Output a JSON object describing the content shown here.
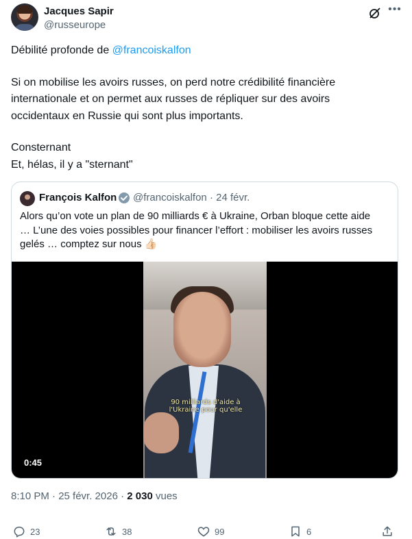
{
  "author": {
    "name": "Jacques Sapir",
    "handle": "@russeurope"
  },
  "tweet": {
    "line1_prefix": "Débilité profonde de ",
    "line1_mention": "@francoiskalfon",
    "para2": "Si on mobilise les avoirs russes, on perd notre crédibilité financière\ninternationale et on permet aux russes de répliquer sur des avoirs\noccidentaux en Russie qui sont plus importants.",
    "para3": "Consternant\nEt, hélas, il y a \"sternant\""
  },
  "quote": {
    "name": "François Kalfon",
    "handle_date": "@francoiskalfon · 24 févr.",
    "text": "Alors qu’on vote un plan de 90 milliards € à Ukraine, Orban bloque cette aide\n… L’une des voies possibles pour financer l’effort : mobiliser les avoirs russes\ngelés … comptez sur nous 👍🏻",
    "video_caption": "90 milliards d'aide à\nl'Ukraine pour qu'elle",
    "duration": "0:45"
  },
  "meta": {
    "time_date": "8:10 PM · 25 févr. 2026 · ",
    "views_count": "2 030",
    "views_label": " vues"
  },
  "actions": {
    "replies": "23",
    "reposts": "38",
    "likes": "99",
    "bookmarks": "6"
  },
  "icons": {
    "grok": "grok-icon",
    "more": "more-icon",
    "verified": "verified-badge-icon",
    "reply": "reply-icon",
    "repost": "repost-icon",
    "like": "heart-icon",
    "bookmark": "bookmark-icon",
    "share": "share-icon"
  },
  "colors": {
    "accent": "#1d9bf0",
    "text": "#0f1419",
    "secondary": "#536471",
    "border": "#cfd9de"
  }
}
